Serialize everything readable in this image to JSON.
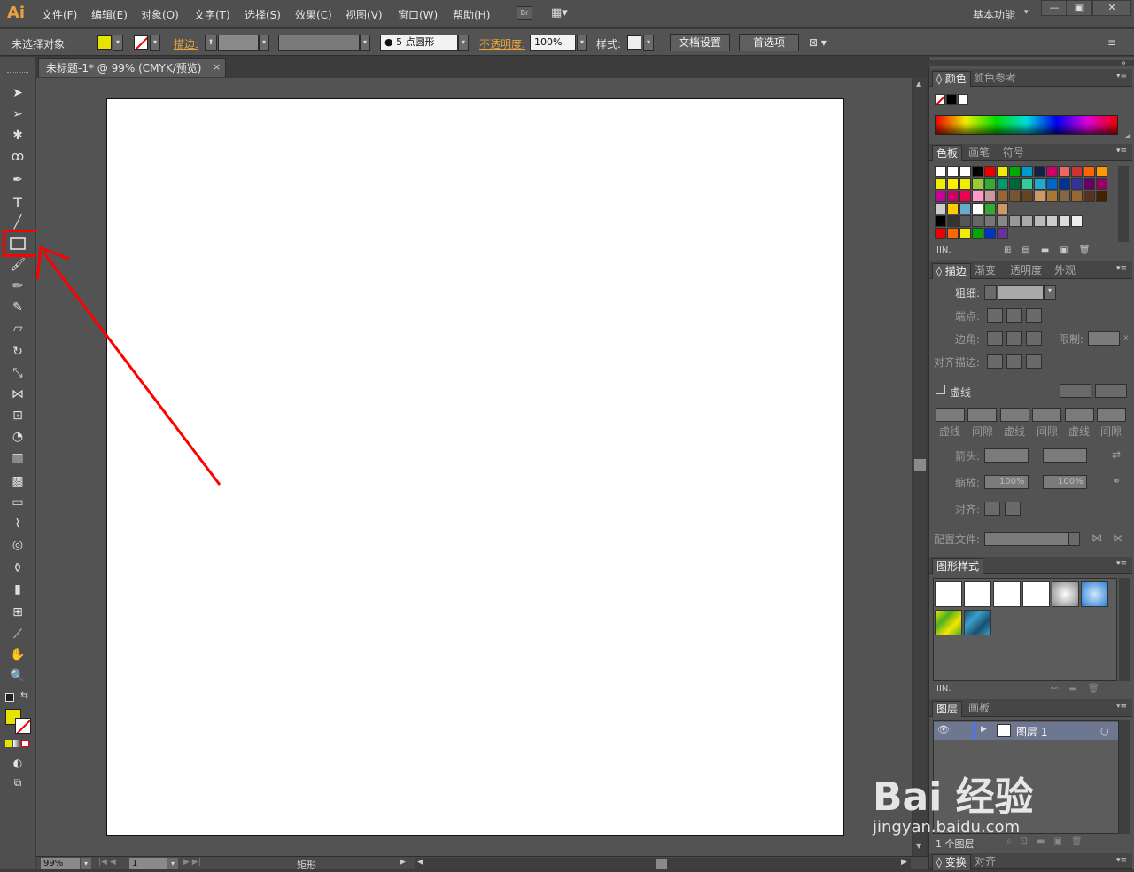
{
  "menubar": {
    "logo": "Ai",
    "items": [
      "文件(F)",
      "编辑(E)",
      "对象(O)",
      "文字(T)",
      "选择(S)",
      "效果(C)",
      "视图(V)",
      "窗口(W)",
      "帮助(H)"
    ],
    "bridge_label": "Br",
    "workspace": "基本功能",
    "window_buttons": [
      "—",
      "▣",
      "✕"
    ]
  },
  "control": {
    "selection": "未选择对象",
    "stroke_label": "描边:",
    "brush": "5 点圆形",
    "opacity_label": "不透明度:",
    "opacity_value": "100%",
    "style_label": "样式:",
    "doc_setup": "文档设置",
    "preferences": "首选项"
  },
  "document": {
    "tab_title": "未标题-1* @ 99% (CMYK/预览)",
    "close": "×"
  },
  "status": {
    "zoom": "99%",
    "artboard": "1",
    "tool": "矩形"
  },
  "panels": {
    "color_tabs": [
      "颜色",
      "颜色参考"
    ],
    "swatch_tabs": [
      "色板",
      "画笔",
      "符号"
    ],
    "stroke_tabs": [
      "描边",
      "渐变",
      "透明度",
      "外观"
    ],
    "stroke": {
      "weight": "粗细:",
      "cap": "端点:",
      "corner": "边角:",
      "limit": "限制:",
      "limit_unit": "x",
      "align": "对齐描边:",
      "dashed": "虚线",
      "dash_labels": [
        "虚线",
        "间隙",
        "虚线",
        "间隙",
        "虚线",
        "间隙"
      ],
      "arrowheads": "箭头:",
      "scale": "缩放:",
      "scale_1": "100%",
      "scale_2": "100%",
      "align_arrows": "对齐:",
      "profile": "配置文件:"
    },
    "graphic_styles_tab": "图形样式",
    "layer_tabs": [
      "图层",
      "画板"
    ],
    "layer_name": "图层 1",
    "layer_count": "1 个图层",
    "bottom_tabs": [
      "变换",
      "对齐"
    ]
  },
  "watermark": {
    "brand": "Bai 经验",
    "url": "jingyan.baidu.com"
  },
  "colors": {
    "fill": "#e4e400",
    "accent": "#e8a33b",
    "highlight": "#ff0000"
  }
}
